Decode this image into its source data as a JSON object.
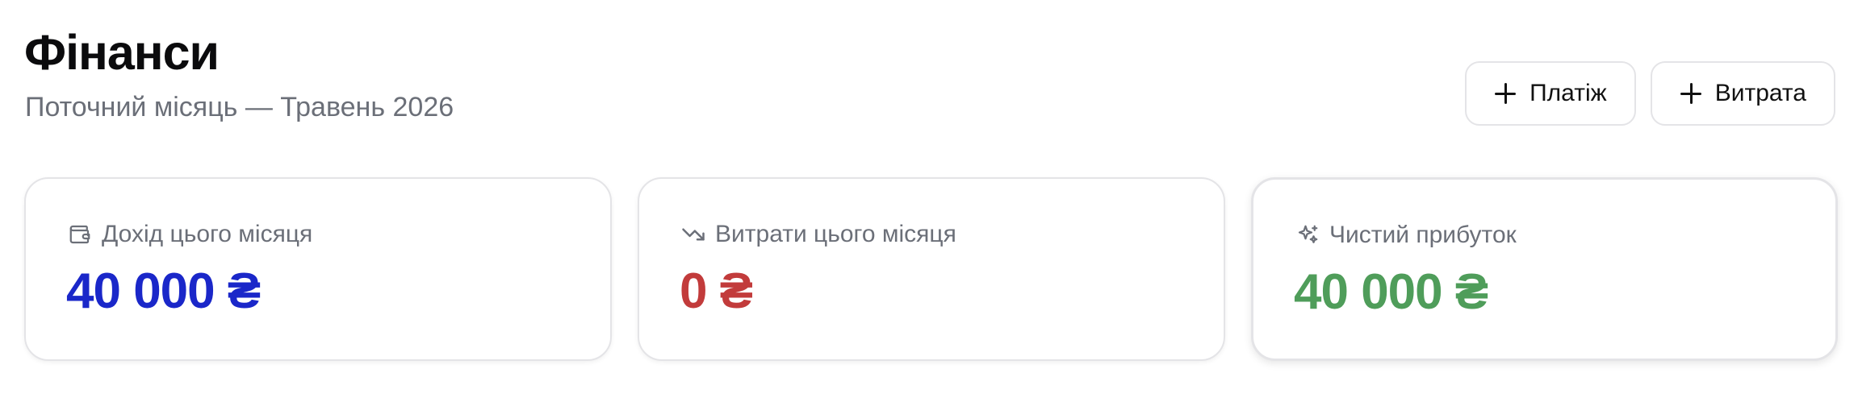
{
  "header": {
    "title": "Фінанси",
    "subtitle": "Поточний місяць — Травень 2026"
  },
  "actions": {
    "payment_label": "Платіж",
    "expense_label": "Витрата",
    "icon": "plus-icon"
  },
  "cards": [
    {
      "label": "Дохід цього місяця",
      "value": "40 000 ₴",
      "icon": "wallet-icon",
      "color": "#1a27c9"
    },
    {
      "label": "Витрати цього місяця",
      "value": "0 ₴",
      "icon": "trending-down-icon",
      "color": "#c23b3b"
    },
    {
      "label": "Чистий прибуток",
      "value": "40 000 ₴",
      "icon": "sparkles-icon",
      "color": "#4f9d5a"
    }
  ]
}
